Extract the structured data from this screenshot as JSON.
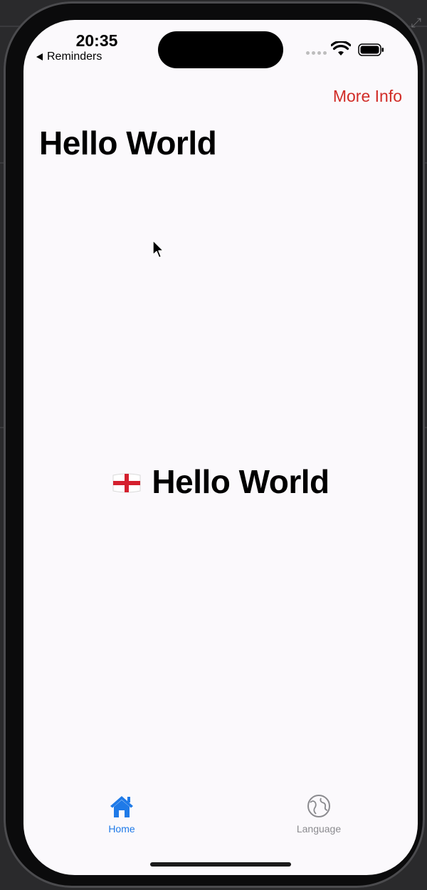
{
  "status_bar": {
    "time": "20:35",
    "back_app_label": "Reminders"
  },
  "nav": {
    "more_info_label": "More Info",
    "title": "Hello World"
  },
  "content": {
    "flag_icon": "england-flag-icon",
    "greeting": "Hello World"
  },
  "tab_bar": {
    "tabs": [
      {
        "label": "Home",
        "icon": "house-fill-icon",
        "selected": true
      },
      {
        "label": "Language",
        "icon": "globe-icon",
        "selected": false
      }
    ]
  },
  "colors": {
    "accent_link": "#d12c27",
    "tab_selected": "#1f7ae8",
    "tab_unselected": "#8b8b8f",
    "background": "#fbf9fc"
  }
}
